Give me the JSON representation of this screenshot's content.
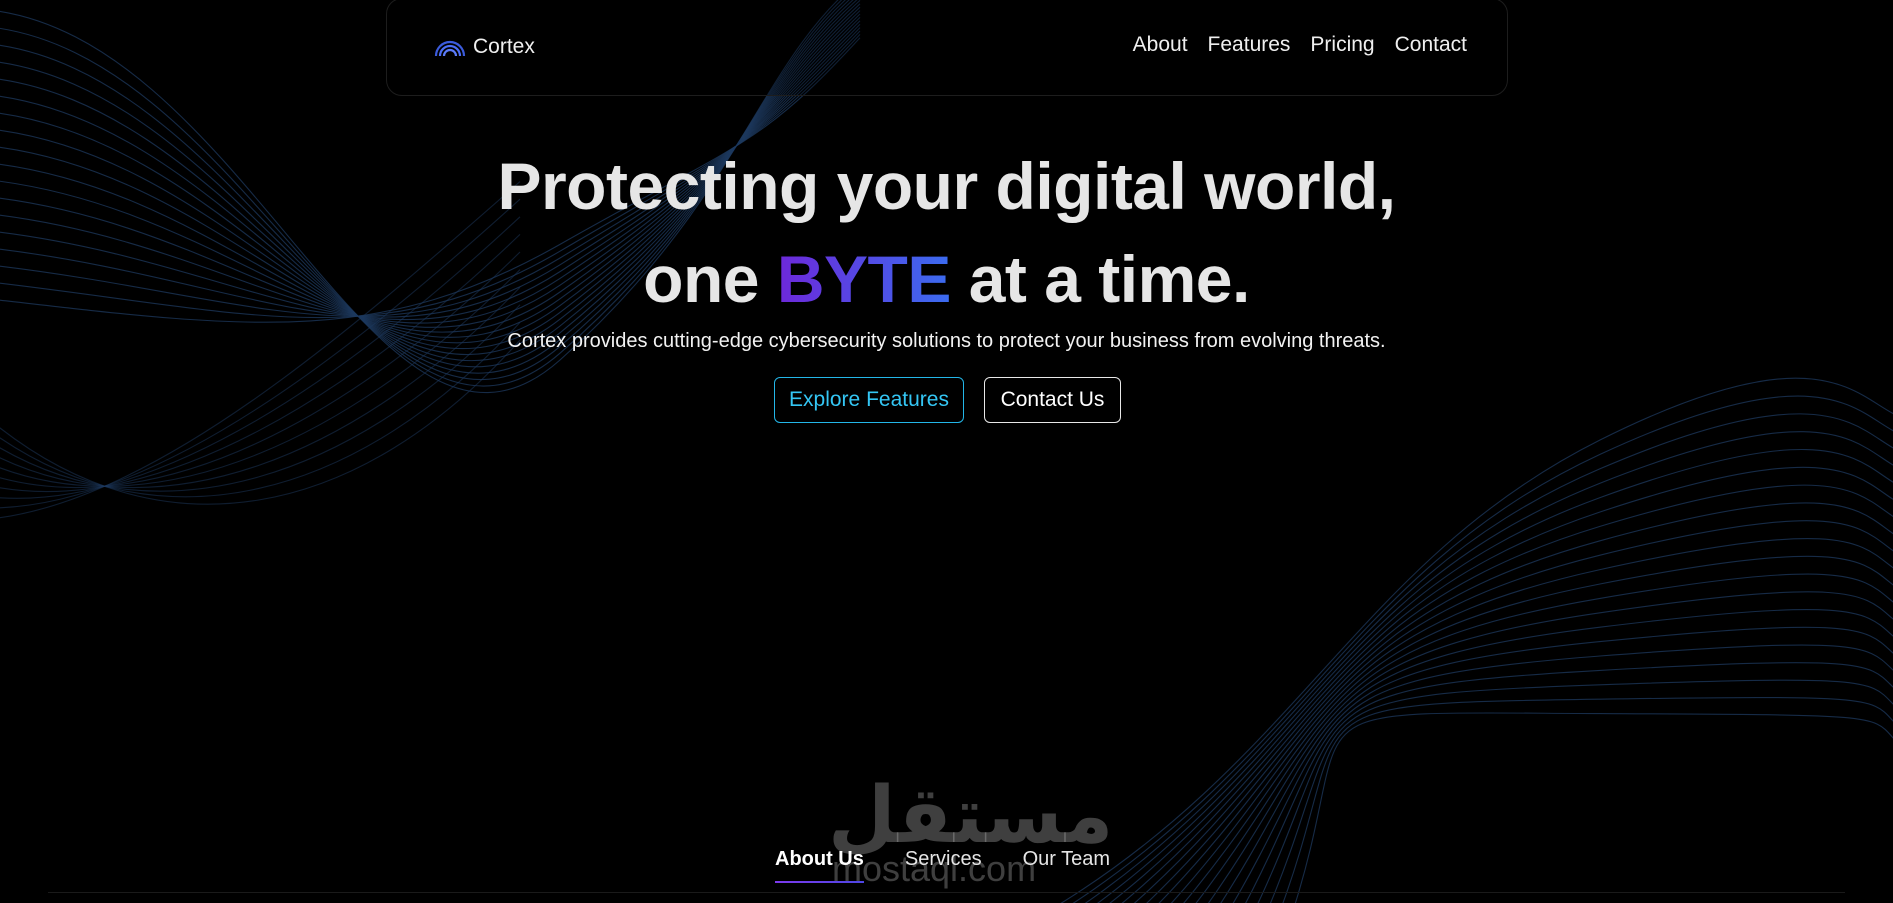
{
  "nav": {
    "brand": "Cortex",
    "brand_icon": "rainbow-arcs-icon",
    "links": [
      "About",
      "Features",
      "Pricing",
      "Contact"
    ]
  },
  "hero": {
    "line1": "Protecting your digital world,",
    "line2_pre": "one",
    "highlight": "BYTE",
    "line2_post": "at a time.",
    "subtitle": "Cortex provides cutting-edge cybersecurity solutions to protect your business from evolving threats.",
    "primary_button": "Explore Features",
    "secondary_button": "Contact Us"
  },
  "watermark": {
    "arabic": "مستقل",
    "latin": "mostaql.com"
  },
  "tabs": {
    "items": [
      "About Us",
      "Services",
      "Our Team"
    ],
    "active": "About Us"
  },
  "colors": {
    "background": "#000000",
    "accent_cyan": "#23b6e8",
    "highlight_start": "#6d28d9",
    "highlight_end": "#3b6cf0",
    "wave_lines": "#1e3a5f"
  }
}
